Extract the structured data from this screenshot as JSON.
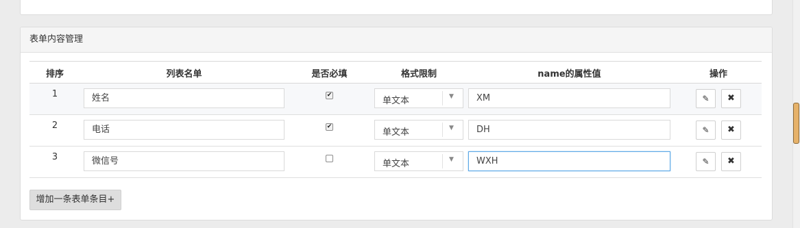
{
  "panel": {
    "title": "表单内容管理"
  },
  "table": {
    "headers": {
      "order": "排序",
      "list_name": "列表名单",
      "required": "是否必填",
      "format": "格式限制",
      "attr": "name的属性值",
      "actions": "操作"
    },
    "rows": [
      {
        "num": "1",
        "name": "姓名",
        "required": true,
        "format": "单文本",
        "attr": "XM"
      },
      {
        "num": "2",
        "name": "电话",
        "required": true,
        "format": "单文本",
        "attr": "DH"
      },
      {
        "num": "3",
        "name": "微信号",
        "required": false,
        "format": "单文本",
        "attr": "WXH"
      }
    ]
  },
  "add_button": "增加一条表单条目+",
  "icons": {
    "edit": "edit-icon",
    "remove": "close-icon",
    "dropdown": "caret-down-icon"
  },
  "colors": {
    "focus_border": "#5aa7e6",
    "scroll_thumb": "#e6b26a"
  }
}
